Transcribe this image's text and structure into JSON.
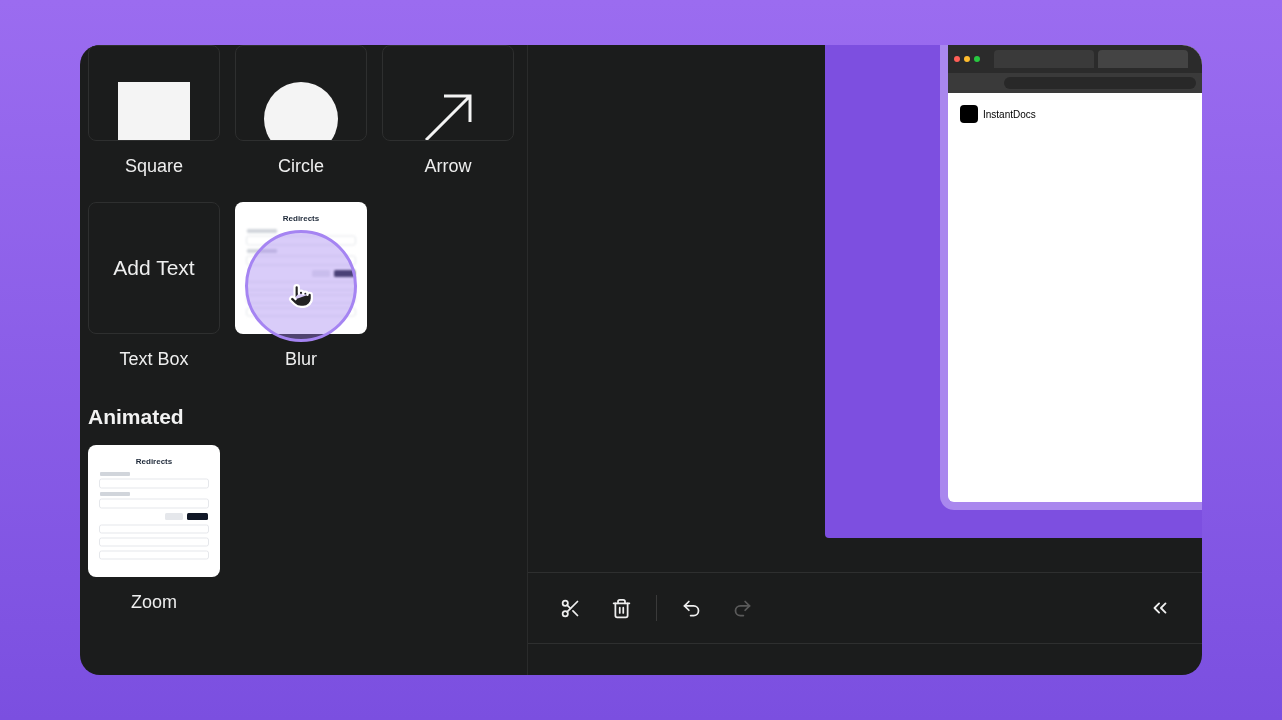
{
  "sections": [
    {
      "items": [
        {
          "kind": "square",
          "label": "Square"
        },
        {
          "kind": "circle",
          "label": "Circle"
        },
        {
          "kind": "arrow",
          "label": "Arrow"
        },
        {
          "kind": "text",
          "label": "Text Box",
          "preview": "Add Text"
        },
        {
          "kind": "blur",
          "label": "Blur",
          "preview": "Redirects"
        }
      ]
    },
    {
      "title": "Animated",
      "items": [
        {
          "kind": "zoom",
          "label": "Zoom",
          "preview": "Redirects"
        }
      ]
    }
  ],
  "preview": {
    "site_title": "InstantDocs"
  },
  "toolbar": [
    {
      "kind": "cut",
      "disabled": false
    },
    {
      "kind": "delete",
      "disabled": false
    },
    {
      "kind": "undo",
      "disabled": false
    },
    {
      "kind": "redo",
      "disabled": true
    }
  ]
}
